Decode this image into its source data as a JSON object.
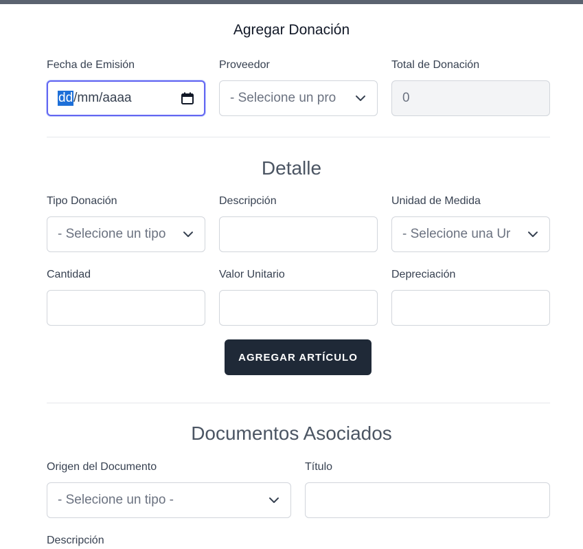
{
  "header": {
    "title": "Agregar Donación"
  },
  "donation": {
    "fecha_label": "Fecha de Emisión",
    "fecha_segment_selected": "dd",
    "fecha_segment_rest": "/mm/aaaa",
    "proveedor_label": "Proveedor",
    "proveedor_value": "- Selecione un pro",
    "total_label": "Total de Donación",
    "total_value": "0"
  },
  "detalle": {
    "title": "Detalle",
    "tipo_label": "Tipo Donación",
    "tipo_value": "- Selecione un tipo",
    "descripcion_label": "Descripción",
    "descripcion_value": "",
    "unidad_label": "Unidad de Medida",
    "unidad_value": "- Selecione una Ur",
    "cantidad_label": "Cantidad",
    "valor_label": "Valor Unitario",
    "depreciacion_label": "Depreciación",
    "add_button": "AGREGAR ARTÍCULO"
  },
  "documentos": {
    "title": "Documentos Asociados",
    "origen_label": "Origen del Documento",
    "origen_value": "- Selecione un tipo -",
    "titulo_label": "Título",
    "descripcion_label": "Descripción"
  },
  "icons": {
    "calendar": "calendar-icon",
    "chevron": "chevron-down-icon"
  },
  "colors": {
    "primary_button": "#1f2937",
    "focus_ring": "#6366f1",
    "date_selection": "#1d6fd8"
  }
}
